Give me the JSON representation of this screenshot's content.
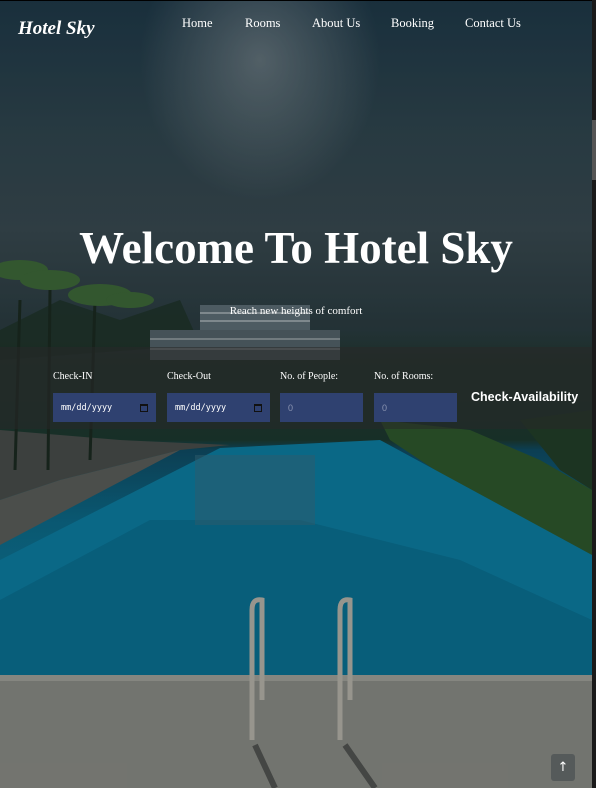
{
  "brand": "Hotel Sky",
  "nav": {
    "home": "Home",
    "rooms": "Rooms",
    "about": "About Us",
    "booking": "Booking",
    "contact": "Contact Us"
  },
  "hero": {
    "title": "Welcome To Hotel Sky",
    "subtitle": "Reach new heights of comfort"
  },
  "booking": {
    "checkin_label": "Check-IN",
    "checkin_value": "mm/dd/yyyy",
    "checkout_label": "Check-Out",
    "checkout_value": "mm/dd/yyyy",
    "people_label": "No. of People:",
    "people_value": "0",
    "rooms_label": "No. of Rooms:",
    "rooms_value": "0",
    "button_label": "Check-Availability"
  },
  "back_to_top_icon": "↑",
  "colors": {
    "input_bg": "#2f4170",
    "booking_bar_bg": "rgba(40,40,40,0.55)"
  },
  "icons": [
    "calendar-icon",
    "arrow-up-icon"
  ]
}
